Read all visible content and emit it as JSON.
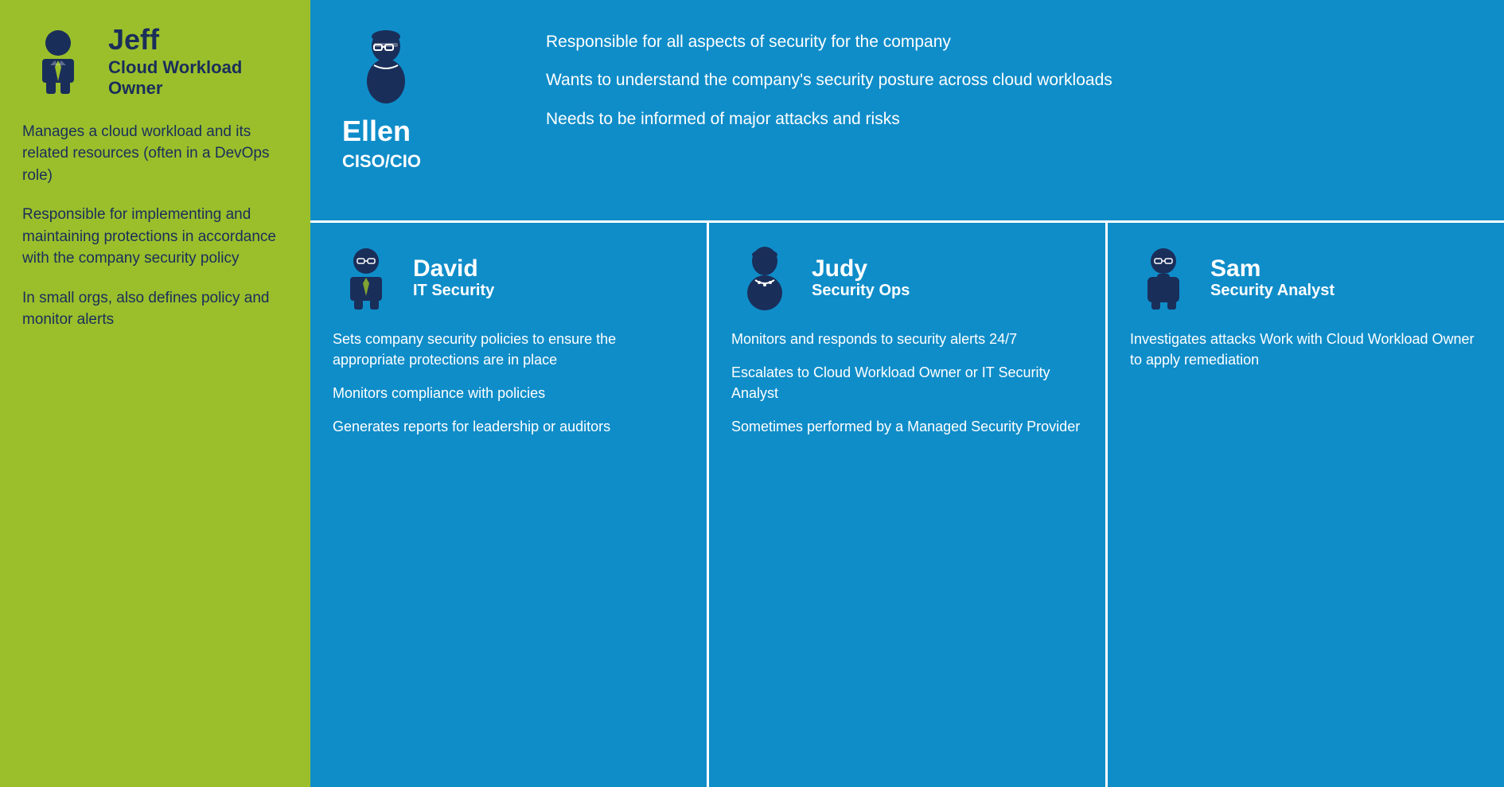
{
  "left": {
    "name": "Jeff",
    "role_line1": "Cloud Workload",
    "role_line2": "Owner",
    "bullets": [
      "Manages a cloud workload and its related resources (often in a DevOps role)",
      "Responsible for implementing and maintaining protections in accordance with the company security policy",
      "In small orgs, also defines policy and monitor alerts"
    ]
  },
  "ellen": {
    "name": "Ellen",
    "role": "CISO/CIO",
    "bullets": [
      "Responsible for all aspects of security for the company",
      "Wants to understand the company's security posture across cloud workloads",
      "Needs to be informed of major attacks and risks"
    ]
  },
  "david": {
    "name": "David",
    "role": "IT Security",
    "bullets": [
      "Sets company security policies to ensure the appropriate protections are in place",
      "Monitors compliance with policies",
      "Generates reports for leadership or auditors"
    ]
  },
  "judy": {
    "name": "Judy",
    "role": "Security Ops",
    "bullets": [
      "Monitors and responds to security alerts 24/7",
      "Escalates to Cloud Workload Owner or IT Security Analyst",
      "Sometimes performed by a Managed Security Provider"
    ]
  },
  "sam": {
    "name": "Sam",
    "role": "Security Analyst",
    "bullets": [
      "Investigates attacks Work with Cloud Workload Owner to apply remediation"
    ]
  },
  "colors": {
    "left_bg": "#9BBF2B",
    "right_bg": "#0F8DC9",
    "dark_navy": "#1a2e5a",
    "white": "#ffffff"
  }
}
